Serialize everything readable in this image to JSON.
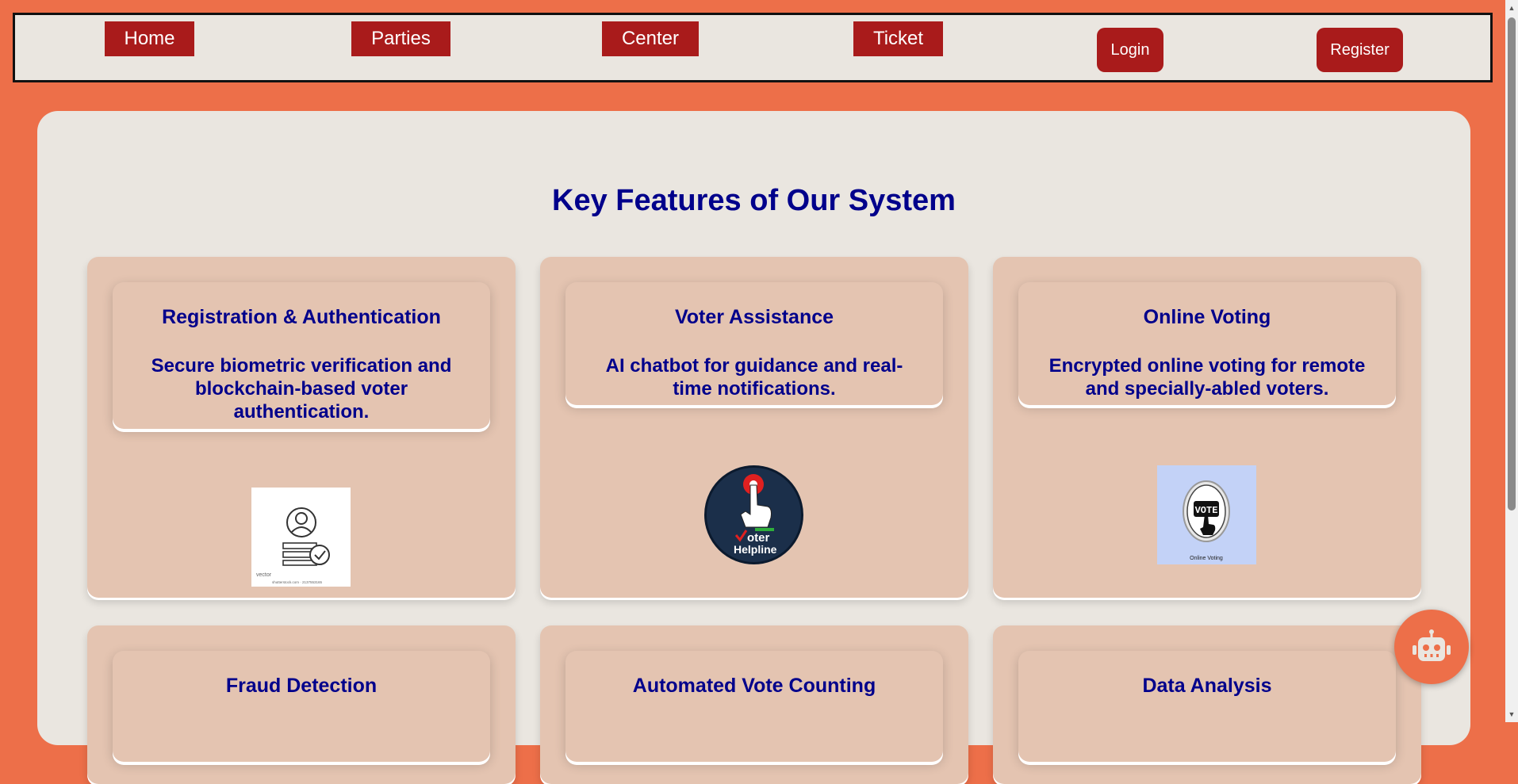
{
  "nav": {
    "home": "Home",
    "parties": "Parties",
    "center": "Center",
    "ticket": "Ticket",
    "login": "Login",
    "register": "Register"
  },
  "section": {
    "heading": "Key Features of Our System"
  },
  "features": [
    {
      "title": "Registration & Authentication",
      "desc": "Secure biometric verification and blockchain-based voter authentication.",
      "image": "user-verified-icon"
    },
    {
      "title": "Voter Assistance",
      "desc": "AI chatbot for guidance and real-time notifications.",
      "image": "voter-helpline-logo"
    },
    {
      "title": "Online Voting",
      "desc": "Encrypted online voting for remote and specially-abled voters.",
      "image": "online-voting-button"
    },
    {
      "title": "Fraud Detection",
      "desc": ""
    },
    {
      "title": "Automated Vote Counting",
      "desc": ""
    },
    {
      "title": "Data Analysis",
      "desc": ""
    }
  ],
  "images": {
    "vector_mark": "vector",
    "stock_id": "shutterstock.com · 2137553165",
    "helpline_word1": "oter",
    "helpline_word2": "Helpline",
    "vote_word": "VOTE",
    "online_voting_caption": "Online Voting"
  },
  "colors": {
    "accent": "#ed6f49",
    "button": "#a91b1b",
    "heading": "#00008b",
    "card": "#e4c4b1",
    "panel": "#eae6e0"
  }
}
